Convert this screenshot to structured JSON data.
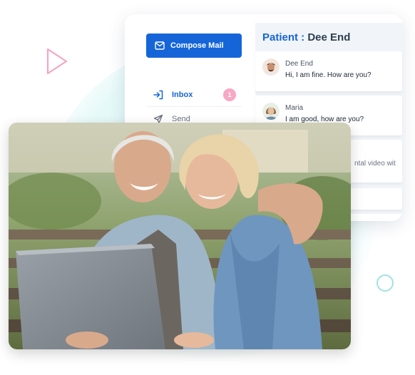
{
  "sidebar": {
    "compose_label": "Compose Mail",
    "items": [
      {
        "label": "Inbox",
        "icon": "inbox-icon",
        "badge": "1",
        "active": true
      },
      {
        "label": "Send",
        "icon": "send-icon",
        "active": false
      }
    ]
  },
  "header": {
    "prefix": "Patient : ",
    "name": "Dee End"
  },
  "messages": [
    {
      "sender": "Dee End",
      "text": "Hi, I am fine. How are you?",
      "icon": "avatar-man-icon"
    },
    {
      "sender": "Maria",
      "text": "I am good, how are you?",
      "icon": "avatar-woman-icon"
    },
    {
      "sender": "",
      "text": "ntal video wit",
      "icon": ""
    }
  ],
  "colors": {
    "accent": "#1565d8",
    "badge": "#f7a8c4",
    "decor_pink": "#f3a6c3",
    "decor_teal": "#9fe3e3"
  }
}
